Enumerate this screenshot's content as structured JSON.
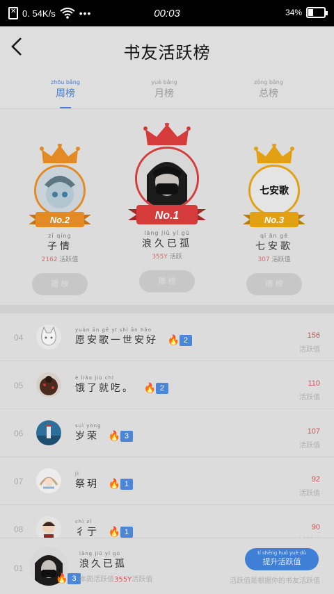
{
  "status_bar": {
    "speed": "0. 54K/s",
    "time": "00:03",
    "battery": "34%",
    "battery_level": 0.34
  },
  "header": {
    "back_icon": "chevron-left-icon",
    "title": "书友活跃榜"
  },
  "tabs": [
    {
      "pinyin": "zhōu bǎng",
      "label": "周榜",
      "active": true
    },
    {
      "pinyin": "yuè bǎng",
      "label": "月榜",
      "active": false
    },
    {
      "pinyin": "zǒng bǎng",
      "label": "总榜",
      "active": false
    }
  ],
  "podium": {
    "first": {
      "badge": "No.1",
      "pinyin": "lāng jiǔ yǐ gū",
      "name": "浪久已孤",
      "score": "355Y",
      "score_label": "活跃",
      "button": "赠 榜"
    },
    "second": {
      "badge": "No.2",
      "pinyin": "zǐ qíng",
      "name": "子情",
      "score": "2162",
      "score_label": "活跃值",
      "button": "赠 榜"
    },
    "third": {
      "badge": "No.3",
      "pinyin": "qī ān gē",
      "name": "七安歌",
      "score": "307",
      "score_label": "活跃值",
      "button": "赠 榜",
      "logo_text": "七安歌"
    }
  },
  "list": [
    {
      "rank": "04",
      "pinyin": "yuàn ān gē yī shì ān hǎo",
      "name": "愿安歌一世安好",
      "level": "2",
      "score": "156",
      "score_label": "活跃值"
    },
    {
      "rank": "05",
      "pinyin": "è liǎo jiù chī",
      "name": "饿了就吃。",
      "level": "2",
      "score": "110",
      "score_label": "活跃值"
    },
    {
      "rank": "06",
      "pinyin": "suì yòng",
      "name": "岁荣",
      "level": "3",
      "score": "107",
      "score_label": "活跃值"
    },
    {
      "rank": "07",
      "pinyin": "jì",
      "name": "祭玥",
      "level": "1",
      "score": "92",
      "score_label": "活跃值"
    },
    {
      "rank": "08",
      "pinyin": "chì zǐ",
      "name": "彳亍",
      "level": "1",
      "score": "90",
      "score_label": "活跃值"
    }
  ],
  "me": {
    "rank": "01",
    "pinyin": "lāng jiǔ yǐ gū",
    "name": "浪久已孤",
    "level": "3",
    "stats_prefix": "本周活跃值",
    "score": "355Y",
    "stats_suffix": "活跃值",
    "boost_pinyin": "tí shēng huó yuè dù",
    "boost_label": "提升活跃值",
    "hint": "活跃值是根据你的书友活跃值"
  },
  "colors": {
    "accent": "#4a7bd0",
    "gold": "#e1a112",
    "red": "#d63b3b",
    "orange": "#e38a24"
  }
}
